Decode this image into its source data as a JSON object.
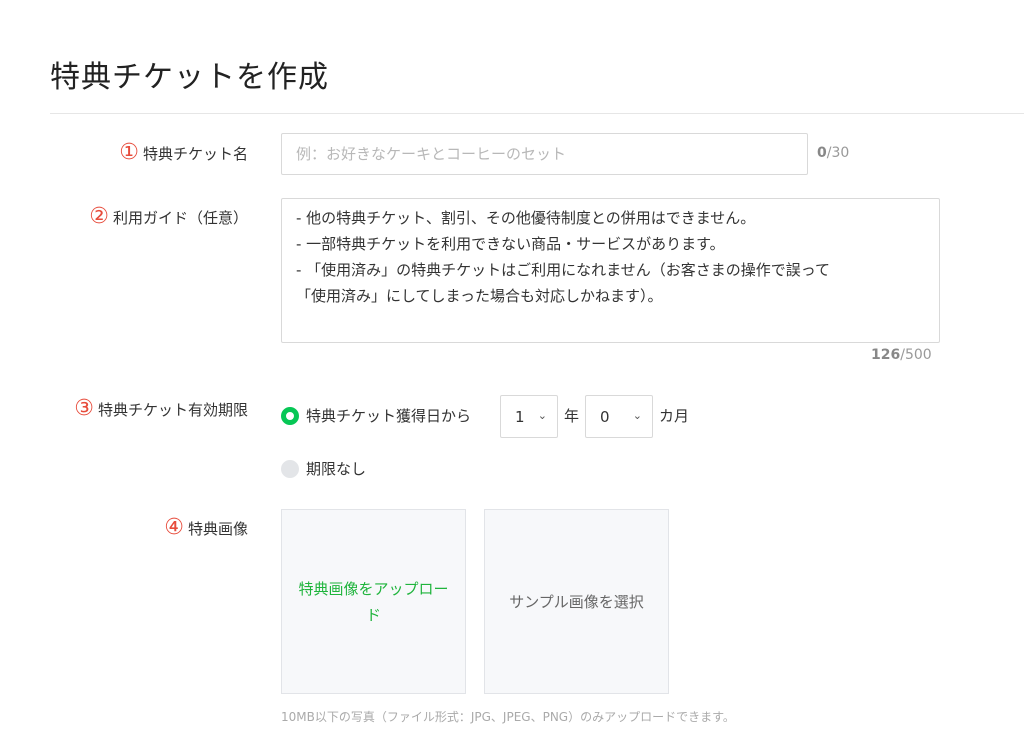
{
  "page": {
    "title": "特典チケットを作成"
  },
  "colors": {
    "accent": "#06c755",
    "marker": "#e74c3c",
    "upload_text": "#1fb43c"
  },
  "fields": {
    "name": {
      "number": "①",
      "label": "特典チケット名",
      "placeholder": "例：お好きなケーキとコーヒーのセット",
      "count": "0",
      "max": "/30"
    },
    "guide": {
      "number": "②",
      "label": "利用ガイド（任意）",
      "lines": [
        "- 他の特典チケット、割引、その他優待制度との併用はできません。",
        "- 一部特典チケットを利用できない商品・サービスがあります。",
        "- 「使用済み」の特典チケットはご利用になれません（お客さまの操作で誤って",
        "「使用済み」にしてしまった場合も対応しかねます）。"
      ],
      "count": "126",
      "max": "/500"
    },
    "validity": {
      "number": "③",
      "label": "特典チケット有効期限",
      "option_from_date": "特典チケット獲得日から",
      "years_value": "1",
      "years_unit": "年",
      "months_value": "0",
      "months_unit": "カ月",
      "option_no_limit": "期限なし"
    },
    "image": {
      "number": "④",
      "label": "特典画像",
      "upload_label": "特典画像をアップロード",
      "sample_label": "サンプル画像を選択",
      "note": "10MB以下の写真（ファイル形式：JPG、JPEG、PNG）のみアップロードできます。"
    }
  }
}
